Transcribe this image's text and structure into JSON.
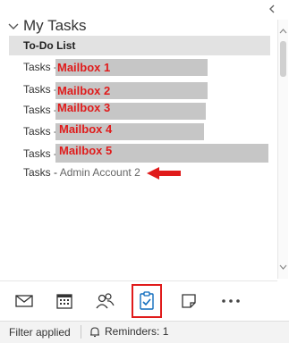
{
  "folder_pane": {
    "group": {
      "label": "My Tasks"
    },
    "items": [
      {
        "label": "To-Do List"
      },
      {
        "prefix": "Tasks - ",
        "annotation": "Mailbox 1"
      },
      {
        "prefix": "Tasks - ",
        "annotation": "Mailbox 2"
      },
      {
        "prefix": "Tasks - ",
        "annotation": "Mailbox 3"
      },
      {
        "prefix": "Tasks - ",
        "annotation": "Mailbox 4"
      },
      {
        "prefix": "Tasks - ",
        "annotation": "Mailbox 5"
      },
      {
        "prefix": "Tasks - ",
        "label": "Admin Account 2"
      }
    ]
  },
  "nav": {
    "items": [
      {
        "icon": "mail-icon"
      },
      {
        "icon": "calendar-icon"
      },
      {
        "icon": "people-icon"
      },
      {
        "icon": "tasks-icon",
        "active": true
      },
      {
        "icon": "notes-icon"
      },
      {
        "icon": "more-icon"
      }
    ]
  },
  "status": {
    "filter": "Filter applied",
    "reminders": "Reminders: 1"
  },
  "colors": {
    "annotation_red": "#e01b1b",
    "selected_bg": "#e2e2e2",
    "redaction_gray": "#c6c6c6",
    "accent_blue": "#0f6cbd"
  }
}
